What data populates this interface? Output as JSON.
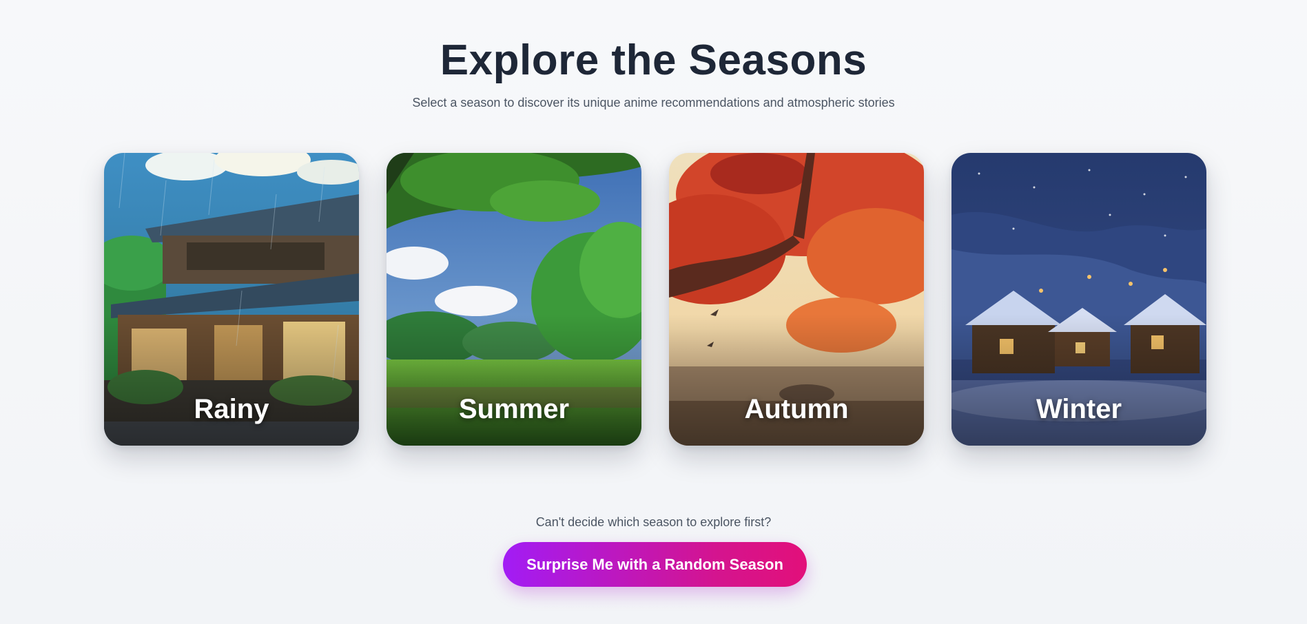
{
  "header": {
    "title": "Explore the Seasons",
    "subtitle": "Select a season to discover its unique anime recommendations and atmospheric stories"
  },
  "seasons": [
    {
      "label": "Rainy"
    },
    {
      "label": "Summer"
    },
    {
      "label": "Autumn"
    },
    {
      "label": "Winter"
    }
  ],
  "random": {
    "prompt": "Can't decide which season to explore first?",
    "button_label": "Surprise Me with a Random Season"
  },
  "colors": {
    "title": "#1e2737",
    "button_start": "#a21cf5",
    "button_end": "#e2107a"
  }
}
